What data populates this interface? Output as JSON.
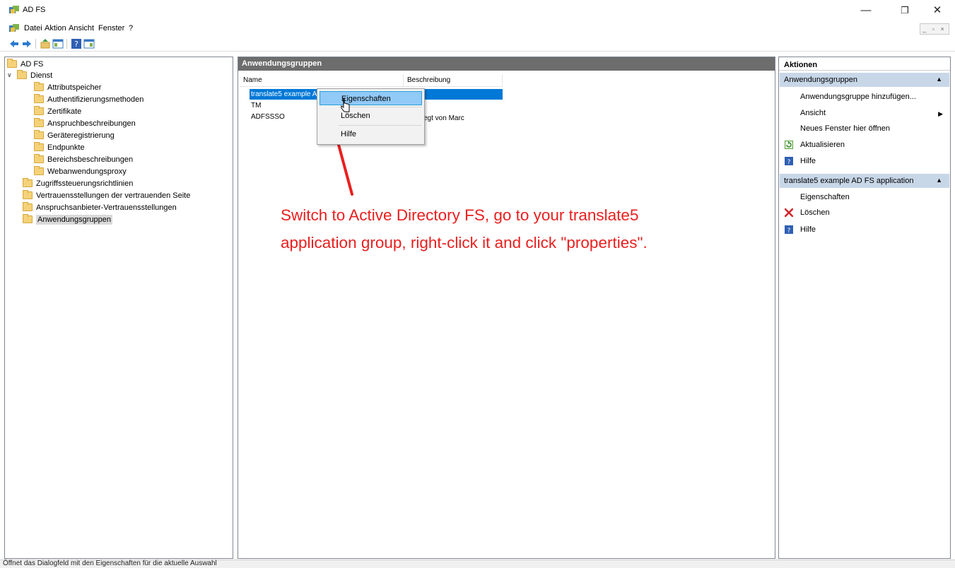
{
  "window": {
    "title": "AD FS",
    "minimize_glyph": "—",
    "restore_glyph": "❐",
    "close_glyph": "✕"
  },
  "menu": [
    "Datei",
    "Aktion",
    "Ansicht",
    "Fenster",
    "?"
  ],
  "mdi_controls": "_ ▫ ×",
  "tree": {
    "root": "AD FS",
    "dienst": "Dienst",
    "dienst_children": [
      "Attributspeicher",
      "Authentifizierungsmethoden",
      "Zertifikate",
      "Anspruchbeschreibungen",
      "Geräteregistrierung",
      "Endpunkte",
      "Bereichsbeschreibungen",
      "Webanwendungsproxy"
    ],
    "top_level": [
      "Zugriffssteuerungsrichtlinien",
      "Vertrauensstellungen der vertrauenden Seite",
      "Anspruchsanbieter-Vertrauensstellungen",
      "Anwendungsgruppen"
    ]
  },
  "center": {
    "title": "Anwendungsgruppen",
    "columns": {
      "name": "Name",
      "description": "Beschreibung"
    },
    "rows": [
      {
        "name": "translate5 example A",
        "description": ""
      },
      {
        "name": "TM",
        "description": ""
      },
      {
        "name": "ADFSSSO",
        "description": "egt von Marc"
      }
    ]
  },
  "context_menu": {
    "items": [
      "Eigenschaften",
      "Löschen",
      "Hilfe"
    ]
  },
  "annotation": {
    "line1": "Switch to Active Directory FS, go to your translate5",
    "line2": "application group, right-click it and click \"properties\".",
    "color": "#e8201f"
  },
  "actions": {
    "title": "Aktionen",
    "section1": {
      "title": "Anwendungsgruppen",
      "items": [
        "Anwendungsgruppe hinzufügen...",
        "Ansicht",
        "Neues Fenster hier öffnen",
        "Aktualisieren",
        "Hilfe"
      ]
    },
    "section2": {
      "title": "translate5 example AD FS application",
      "items": [
        "Eigenschaften",
        "Löschen",
        "Hilfe"
      ]
    }
  },
  "status": {
    "text": "Öffnet das Dialogfeld mit den Eigenschaften für die aktuelle Auswahl"
  },
  "colors": {
    "selection": "#0078d7",
    "menu_highlight": "#91c9f7",
    "action_section": "#c8d7e8",
    "pane_header": "#6d6d6d"
  }
}
